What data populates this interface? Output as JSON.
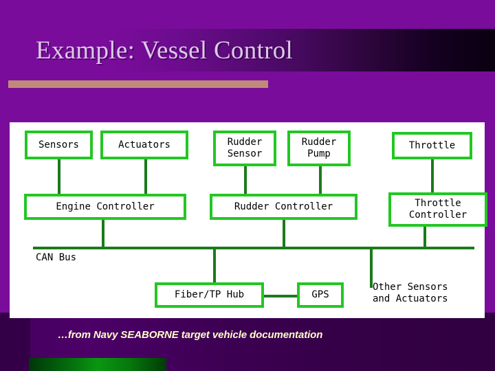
{
  "slide": {
    "title": "Example: Vessel Control",
    "caption": "…from Navy SEABORNE target vehicle documentation",
    "colors": {
      "background_purple": "#7A0C9C",
      "title_text": "#DCC9E8",
      "title_rule": "#C08A78",
      "panel_background": "#FFFFFF",
      "node_border_green": "#23C723",
      "connector_green": "#1B7A1B",
      "caption_text": "#FFFFCB",
      "bottom_bar_green": "#0A9611"
    }
  },
  "diagram": {
    "nodes": [
      {
        "id": "sensors",
        "label": "Sensors"
      },
      {
        "id": "actuators",
        "label": "Actuators"
      },
      {
        "id": "rudder-sensor",
        "label": "Rudder\nSensor"
      },
      {
        "id": "rudder-pump",
        "label": "Rudder\nPump"
      },
      {
        "id": "throttle",
        "label": "Throttle"
      },
      {
        "id": "engine-controller",
        "label": "Engine Controller"
      },
      {
        "id": "rudder-controller",
        "label": "Rudder Controller"
      },
      {
        "id": "throttle-controller",
        "label": "Throttle\nController"
      },
      {
        "id": "fiber-tp-hub",
        "label": "Fiber/TP Hub"
      },
      {
        "id": "gps",
        "label": "GPS"
      }
    ],
    "labels": [
      {
        "id": "can-bus",
        "label": "CAN Bus"
      },
      {
        "id": "other-sensors",
        "label": "Other Sensors\nand Actuators"
      }
    ]
  }
}
